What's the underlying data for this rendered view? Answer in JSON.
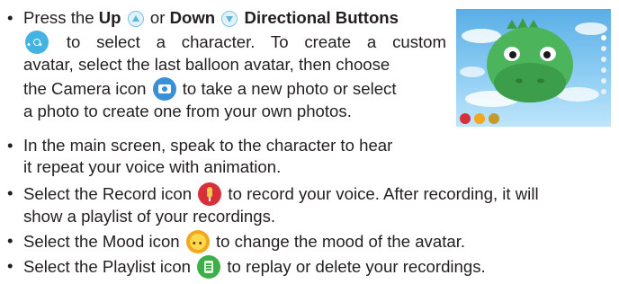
{
  "bullet_char": "•",
  "para1": {
    "l1_t1": "Press the ",
    "l1_b1": "Up",
    "l1_t2": " or ",
    "l1_b2": "Down",
    "l1_b3": "Directional Buttons",
    "l2": "to select a character. To create a custom",
    "l3": "avatar, select the last balloon avatar, then choose",
    "l4_a": "the Camera icon",
    "l4_b": "to take a new photo or select",
    "l5": "a photo to create one from your own photos."
  },
  "para2": {
    "l1": "In the main screen, speak to the character to hear",
    "l2": "it repeat your voice with animation."
  },
  "para3": {
    "l1_a": "Select the Record icon",
    "l1_b": "to record your voice. After recording, it will",
    "l2": "show a playlist of your recordings."
  },
  "para4": {
    "a": "Select the Mood icon",
    "b": "to change the mood of the avatar."
  },
  "para5": {
    "a": "Select the Playlist icon",
    "b": "to replay or delete your recordings."
  },
  "icons": {
    "up": "up-arrow-icon",
    "down": "down-arrow-icon",
    "dpad": "directional-pad-icon",
    "camera": "camera-icon",
    "record": "record-microphone-icon",
    "mood": "mood-face-icon",
    "playlist": "playlist-icon"
  },
  "colors": {
    "text": "#231f20",
    "dinosaur": "#4cb45a",
    "sky": "#5aaee6",
    "record": "#d6303a",
    "mood": "#f2a81d",
    "playlist": "#3cae4a",
    "camera": "#3a8fd6"
  }
}
